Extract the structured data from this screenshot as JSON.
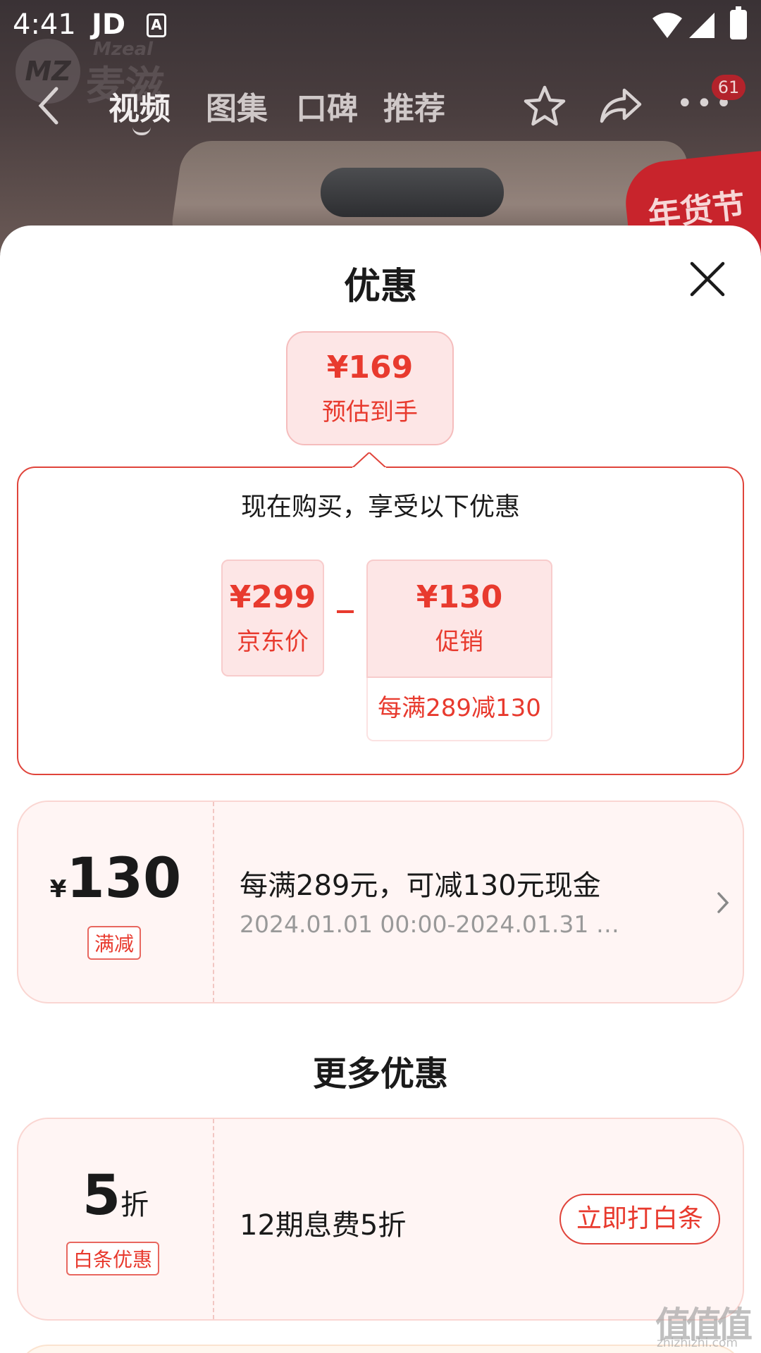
{
  "status_bar": {
    "time": "4:41",
    "carrier": "JD",
    "app_icon": "A"
  },
  "background": {
    "brand_en": "Mzeal",
    "brand_cn": "麦滋",
    "logo_mark": "MZ",
    "badge_text": "年货节"
  },
  "nav": {
    "tabs": [
      "视频",
      "图集",
      "口碑",
      "推荐"
    ],
    "active_tab": "视频",
    "message_count": "61"
  },
  "sheet": {
    "title": "优惠",
    "estimate": {
      "price": "¥169",
      "label": "预估到手"
    },
    "summary": {
      "heading": "现在购买，享受以下优惠",
      "jd_price": {
        "value": "¥299",
        "label": "京东价"
      },
      "promo": {
        "value": "¥130",
        "label": "促销",
        "rule": "每满289减130"
      }
    },
    "coupon_main": {
      "currency": "¥",
      "amount": "130",
      "tag": "满减",
      "title": "每满289元，可减130元现金",
      "validity": "2024.01.01 00:00-2024.01.31 2..."
    },
    "more_title": "更多优惠",
    "coupon_baitiao": {
      "amount": "5",
      "unit": "折",
      "tag": "白条优惠",
      "title": "12期息费5折",
      "cta": "立即打白条"
    }
  },
  "watermark": {
    "text": "值值值",
    "domain": "zhizhizhi.com"
  },
  "colors": {
    "accent_red": "#e83a2e",
    "pink_bg": "#fde6e6",
    "card_bg": "#fff5f4"
  },
  "icons": [
    "back-icon",
    "star-icon",
    "share-icon",
    "more-icon",
    "close-icon",
    "chevron-right-icon",
    "wifi-icon",
    "signal-icon",
    "battery-icon"
  ]
}
